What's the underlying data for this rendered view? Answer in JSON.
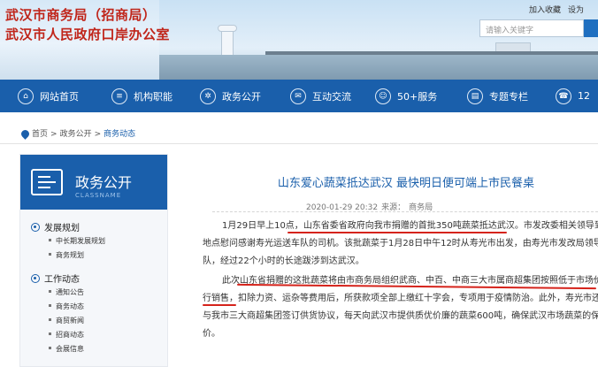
{
  "header": {
    "title_line1": "武汉市商务局（招商局）",
    "title_line2": "武汉市人民政府口岸办公室",
    "top_links": [
      "加入收藏",
      "设为"
    ],
    "search_placeholder": "请输入关键字"
  },
  "nav": {
    "items": [
      {
        "label": "网站首页",
        "icon": "home-icon"
      },
      {
        "label": "机构职能",
        "icon": "org-icon"
      },
      {
        "label": "政务公开",
        "icon": "gear-icon"
      },
      {
        "label": "互动交流",
        "icon": "chat-icon"
      },
      {
        "label": "50+服务",
        "icon": "service-icon"
      },
      {
        "label": "专题专栏",
        "icon": "topic-icon"
      },
      {
        "label": "12",
        "icon": "phone-icon"
      }
    ]
  },
  "breadcrumb": {
    "items": [
      "首页",
      "政务公开",
      "商务动态"
    ],
    "separator": ">"
  },
  "sidebar": {
    "title": "政务公开",
    "subtitle": "CLASSNAME",
    "sections": [
      {
        "label": "发展规划",
        "items": [
          "中长期发展规划",
          "商务规划"
        ]
      },
      {
        "label": "工作动态",
        "items": [
          "通知公告",
          "商务动态",
          "商贸新闻",
          "招商动态",
          "会展信息"
        ]
      }
    ]
  },
  "article": {
    "title": "山东爱心蔬菜抵达武汉 最快明日便可端上市民餐桌",
    "date": "2020-01-29 20:32",
    "source_label": "来源：",
    "source": "商务局",
    "paragraph1": {
      "line1_a": "1月29日早上10点，",
      "line1_b": "山东省委省政府向我市捐赠的首批350吨蔬菜抵达武汉",
      "line1_c": "。市发改委相关领导到交接",
      "line2": "地点慰问感谢寿光运送车队的司机。该批蔬菜于1月28日中午12时从寿光市出发，由寿光市发改局领导带",
      "line3": "队，经过22个小时的长途跋涉到达武汉。"
    },
    "paragraph2": {
      "line1_a": "此次",
      "line1_b": "山东省捐赠的这批蔬菜将由市商务局组织武商、中百、中商三大市属商超集团按照低于市场价进",
      "line2_a": "行销售",
      "line2_b": "，扣除力资、运杂等费用后，所获款项全部上缴红十字会，专项用于疫情防治。此外，寿光市还将",
      "line3": "与我市三大商超集团签订供货协议，每天向武汉市提供质优价廉的蔬菜600吨，确保武汉市场蔬菜的保供稳",
      "line4": "价。"
    }
  },
  "colors": {
    "brand_red": "#c0251a",
    "nav_blue": "#1a5fab",
    "annotation_red": "#d5231b"
  }
}
